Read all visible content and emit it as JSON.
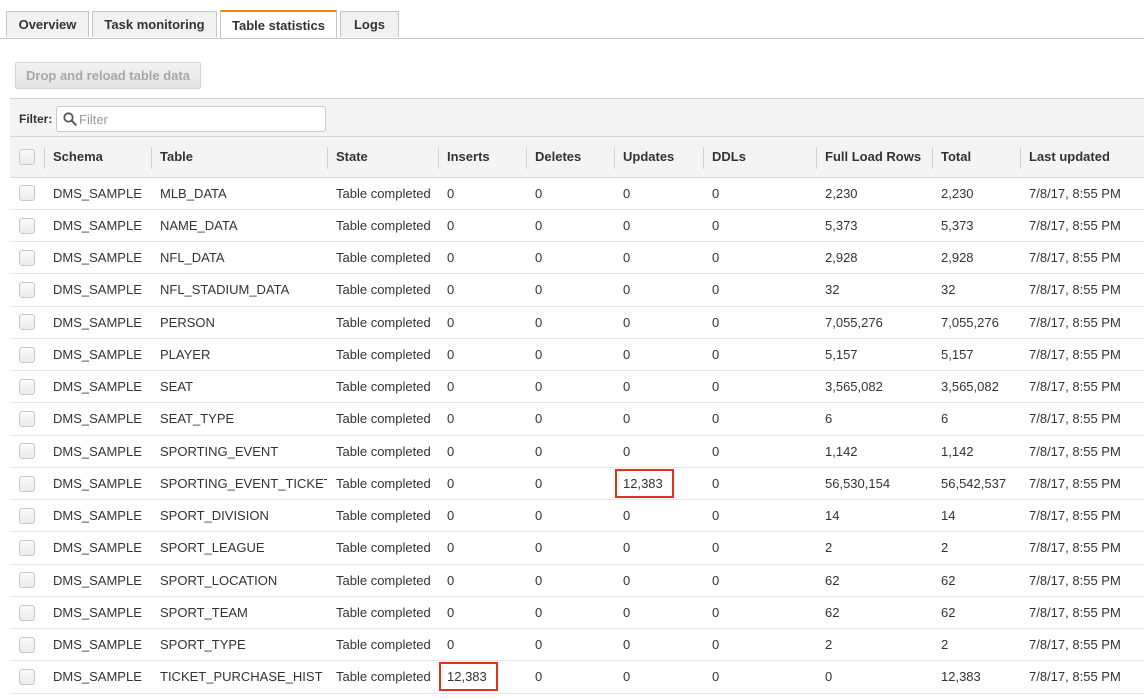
{
  "tabs": [
    {
      "label": "Overview",
      "active": false
    },
    {
      "label": "Task monitoring",
      "active": false
    },
    {
      "label": "Table statistics",
      "active": true
    },
    {
      "label": "Logs",
      "active": false
    }
  ],
  "toolbar": {
    "drop_reload_label": "Drop and reload table data"
  },
  "filter": {
    "label": "Filter:",
    "placeholder": "Filter",
    "icon": "search-icon"
  },
  "colors": {
    "tab_accent": "#e68b18",
    "highlight": "#e0321e"
  },
  "table": {
    "columns": [
      "Schema",
      "Table",
      "State",
      "Inserts",
      "Deletes",
      "Updates",
      "DDLs",
      "Full Load Rows",
      "Total",
      "Last updated"
    ],
    "rows": [
      {
        "schema": "DMS_SAMPLE",
        "table": "MLB_DATA",
        "state": "Table completed",
        "inserts": "0",
        "deletes": "0",
        "updates": "0",
        "ddls": "0",
        "full_load_rows": "2,230",
        "total": "2,230",
        "last_updated": "7/8/17, 8:55 PM"
      },
      {
        "schema": "DMS_SAMPLE",
        "table": "NAME_DATA",
        "state": "Table completed",
        "inserts": "0",
        "deletes": "0",
        "updates": "0",
        "ddls": "0",
        "full_load_rows": "5,373",
        "total": "5,373",
        "last_updated": "7/8/17, 8:55 PM"
      },
      {
        "schema": "DMS_SAMPLE",
        "table": "NFL_DATA",
        "state": "Table completed",
        "inserts": "0",
        "deletes": "0",
        "updates": "0",
        "ddls": "0",
        "full_load_rows": "2,928",
        "total": "2,928",
        "last_updated": "7/8/17, 8:55 PM"
      },
      {
        "schema": "DMS_SAMPLE",
        "table": "NFL_STADIUM_DATA",
        "state": "Table completed",
        "inserts": "0",
        "deletes": "0",
        "updates": "0",
        "ddls": "0",
        "full_load_rows": "32",
        "total": "32",
        "last_updated": "7/8/17, 8:55 PM"
      },
      {
        "schema": "DMS_SAMPLE",
        "table": "PERSON",
        "state": "Table completed",
        "inserts": "0",
        "deletes": "0",
        "updates": "0",
        "ddls": "0",
        "full_load_rows": "7,055,276",
        "total": "7,055,276",
        "last_updated": "7/8/17, 8:55 PM"
      },
      {
        "schema": "DMS_SAMPLE",
        "table": "PLAYER",
        "state": "Table completed",
        "inserts": "0",
        "deletes": "0",
        "updates": "0",
        "ddls": "0",
        "full_load_rows": "5,157",
        "total": "5,157",
        "last_updated": "7/8/17, 8:55 PM"
      },
      {
        "schema": "DMS_SAMPLE",
        "table": "SEAT",
        "state": "Table completed",
        "inserts": "0",
        "deletes": "0",
        "updates": "0",
        "ddls": "0",
        "full_load_rows": "3,565,082",
        "total": "3,565,082",
        "last_updated": "7/8/17, 8:55 PM"
      },
      {
        "schema": "DMS_SAMPLE",
        "table": "SEAT_TYPE",
        "state": "Table completed",
        "inserts": "0",
        "deletes": "0",
        "updates": "0",
        "ddls": "0",
        "full_load_rows": "6",
        "total": "6",
        "last_updated": "7/8/17, 8:55 PM"
      },
      {
        "schema": "DMS_SAMPLE",
        "table": "SPORTING_EVENT",
        "state": "Table completed",
        "inserts": "0",
        "deletes": "0",
        "updates": "0",
        "ddls": "0",
        "full_load_rows": "1,142",
        "total": "1,142",
        "last_updated": "7/8/17, 8:55 PM"
      },
      {
        "schema": "DMS_SAMPLE",
        "table": "SPORTING_EVENT_TICKET",
        "state": "Table completed",
        "inserts": "0",
        "deletes": "0",
        "updates": "12,383",
        "ddls": "0",
        "full_load_rows": "56,530,154",
        "total": "56,542,537",
        "last_updated": "7/8/17, 8:55 PM"
      },
      {
        "schema": "DMS_SAMPLE",
        "table": "SPORT_DIVISION",
        "state": "Table completed",
        "inserts": "0",
        "deletes": "0",
        "updates": "0",
        "ddls": "0",
        "full_load_rows": "14",
        "total": "14",
        "last_updated": "7/8/17, 8:55 PM"
      },
      {
        "schema": "DMS_SAMPLE",
        "table": "SPORT_LEAGUE",
        "state": "Table completed",
        "inserts": "0",
        "deletes": "0",
        "updates": "0",
        "ddls": "0",
        "full_load_rows": "2",
        "total": "2",
        "last_updated": "7/8/17, 8:55 PM"
      },
      {
        "schema": "DMS_SAMPLE",
        "table": "SPORT_LOCATION",
        "state": "Table completed",
        "inserts": "0",
        "deletes": "0",
        "updates": "0",
        "ddls": "0",
        "full_load_rows": "62",
        "total": "62",
        "last_updated": "7/8/17, 8:55 PM"
      },
      {
        "schema": "DMS_SAMPLE",
        "table": "SPORT_TEAM",
        "state": "Table completed",
        "inserts": "0",
        "deletes": "0",
        "updates": "0",
        "ddls": "0",
        "full_load_rows": "62",
        "total": "62",
        "last_updated": "7/8/17, 8:55 PM"
      },
      {
        "schema": "DMS_SAMPLE",
        "table": "SPORT_TYPE",
        "state": "Table completed",
        "inserts": "0",
        "deletes": "0",
        "updates": "0",
        "ddls": "0",
        "full_load_rows": "2",
        "total": "2",
        "last_updated": "7/8/17, 8:55 PM"
      },
      {
        "schema": "DMS_SAMPLE",
        "table": "TICKET_PURCHASE_HIST",
        "state": "Table completed",
        "inserts": "12,383",
        "deletes": "0",
        "updates": "0",
        "ddls": "0",
        "full_load_rows": "0",
        "total": "12,383",
        "last_updated": "7/8/17, 8:55 PM"
      }
    ]
  }
}
